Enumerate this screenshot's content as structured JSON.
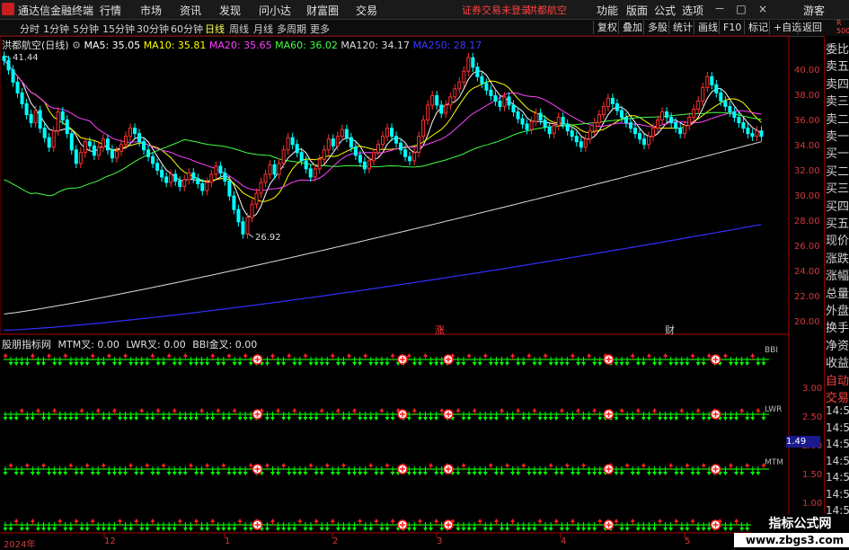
{
  "app": {
    "title": "通达信金融终端"
  },
  "menu": [
    "行情",
    "市场",
    "资讯",
    "发现",
    "问小达",
    "财富圈",
    "交易"
  ],
  "notice": "证券交易未登录",
  "top_stock": "洪都航空",
  "right_menu": [
    "功能",
    "版面",
    "公式",
    "选项"
  ],
  "window_buttons": {
    "minimize": "－",
    "maximize": "□",
    "close": "×"
  },
  "guest": "游客",
  "periods": [
    {
      "label": "分时",
      "active": false
    },
    {
      "label": "1分钟",
      "active": false
    },
    {
      "label": "5分钟",
      "active": false
    },
    {
      "label": "15分钟",
      "active": false
    },
    {
      "label": "30分钟",
      "active": false
    },
    {
      "label": "60分钟",
      "active": false
    },
    {
      "label": "日线",
      "active": true
    },
    {
      "label": "周线",
      "active": false
    },
    {
      "label": "月线",
      "active": false
    },
    {
      "label": "多周期",
      "active": false
    },
    {
      "label": "更多",
      "active": false
    }
  ],
  "tools": [
    "复权",
    "叠加",
    "多股",
    "统计",
    "画线",
    "F10",
    "标记",
    "+自选",
    "返回"
  ],
  "rk": {
    "line1": "R",
    "line2": "500"
  },
  "chart_header": {
    "name": "洪都航空(日线)",
    "ma": [
      {
        "label": "MA5: 35.05",
        "color": "#ffffff"
      },
      {
        "label": "MA10: 35.81",
        "color": "#ffff00"
      },
      {
        "label": "MA20: 35.65",
        "color": "#ff44ff"
      },
      {
        "label": "MA60: 36.02",
        "color": "#44ff44"
      },
      {
        "label": "MA120: 34.17",
        "color": "#dddddd"
      },
      {
        "label": "MA250: 28.17",
        "color": "#3a3aff"
      }
    ]
  },
  "right_panel": [
    "委比",
    "卖五",
    "卖四",
    "卖三",
    "卖二",
    "卖一",
    "买一",
    "买二",
    "买三",
    "买四",
    "买五",
    "现价",
    "涨跌",
    "涨幅",
    "总量",
    "外盘",
    "换手",
    "净资",
    "收益",
    "自动",
    "交易"
  ],
  "right_times": [
    "14:56",
    "14:56",
    "14:56",
    "14:56",
    "14:56",
    "14:56",
    "14:56",
    "14:56"
  ],
  "indicator": {
    "title": "股朋指标网",
    "labels": [
      "MTM叉: 0.00",
      "LWR叉: 0.00",
      "BBI金叉: 0.00"
    ],
    "cursor_value": "1.49",
    "row_tags": [
      "BBI",
      "LWR",
      "MTM"
    ],
    "ticks": [
      "3.00",
      "2.50",
      "2.00",
      "1.50",
      "1.00",
      "0.50"
    ]
  },
  "price_ticks": [
    "40.00",
    "38.00",
    "36.00",
    "34.00",
    "32.00",
    "30.00",
    "28.00",
    "26.00",
    "24.00",
    "22.00",
    "20.00"
  ],
  "annotations": {
    "high": "41.44",
    "low": "26.92",
    "mark1": "涨",
    "mark2": "财"
  },
  "time_axis": [
    "2024年",
    "12",
    "1",
    "2",
    "3",
    "4",
    "5"
  ],
  "watermark": {
    "line1": "指标公式网",
    "line2": "www.zbgs3.com"
  },
  "chart_data": {
    "type": "candlestick",
    "title": "洪都航空(日线)",
    "ylim": [
      20,
      42
    ],
    "high_label": 41.44,
    "low_label": 26.92,
    "closes": [
      40.2,
      39.5,
      38.6,
      37.8,
      37.0,
      36.2,
      35.6,
      36.5,
      35.2,
      34.5,
      33.8,
      35.0,
      36.4,
      35.8,
      34.8,
      33.6,
      32.6,
      33.4,
      34.2,
      33.9,
      33.2,
      33.8,
      34.4,
      33.6,
      33.0,
      33.5,
      34.0,
      34.6,
      35.2,
      34.8,
      34.2,
      33.6,
      33.1,
      32.6,
      32.1,
      31.6,
      31.2,
      31.8,
      31.3,
      30.9,
      31.4,
      31.9,
      31.5,
      31.1,
      30.6,
      31.2,
      31.8,
      32.4,
      31.9,
      31.3,
      30.2,
      29.2,
      28.3,
      27.4,
      28.6,
      29.6,
      30.4,
      31.2,
      31.8,
      32.5,
      31.8,
      32.6,
      33.6,
      34.5,
      34.0,
      33.4,
      32.8,
      32.2,
      31.6,
      32.2,
      32.9,
      33.6,
      34.4,
      33.9,
      34.6,
      35.1,
      34.5,
      33.8,
      33.2,
      32.7,
      32.2,
      32.8,
      33.4,
      34.0,
      34.6,
      35.2,
      34.6,
      34.1,
      33.6,
      33.1,
      32.8,
      33.4,
      34.6,
      35.8,
      36.9,
      37.6,
      36.9,
      36.3,
      36.9,
      37.5,
      38.1,
      38.6,
      39.4,
      40.4,
      39.7,
      39.0,
      38.5,
      38.0,
      37.6,
      37.2,
      36.8,
      37.5,
      36.9,
      36.4,
      35.9,
      35.5,
      35.1,
      35.7,
      36.3,
      35.8,
      35.3,
      34.8,
      35.4,
      36.0,
      35.5,
      35.0,
      34.6,
      34.2,
      33.8,
      34.4,
      35.0,
      35.6,
      36.2,
      36.8,
      37.4,
      37.0,
      36.5,
      36.0,
      35.6,
      35.2,
      34.8,
      34.4,
      34.0,
      34.6,
      35.2,
      35.8,
      36.4,
      36.0,
      35.6,
      35.2,
      34.8,
      35.4,
      36.0,
      36.6,
      37.2,
      38.2,
      39.0,
      38.4,
      37.8,
      37.2,
      36.8,
      36.4,
      36.0,
      35.6,
      35.2,
      34.8,
      34.6,
      35.0,
      34.6
    ]
  }
}
